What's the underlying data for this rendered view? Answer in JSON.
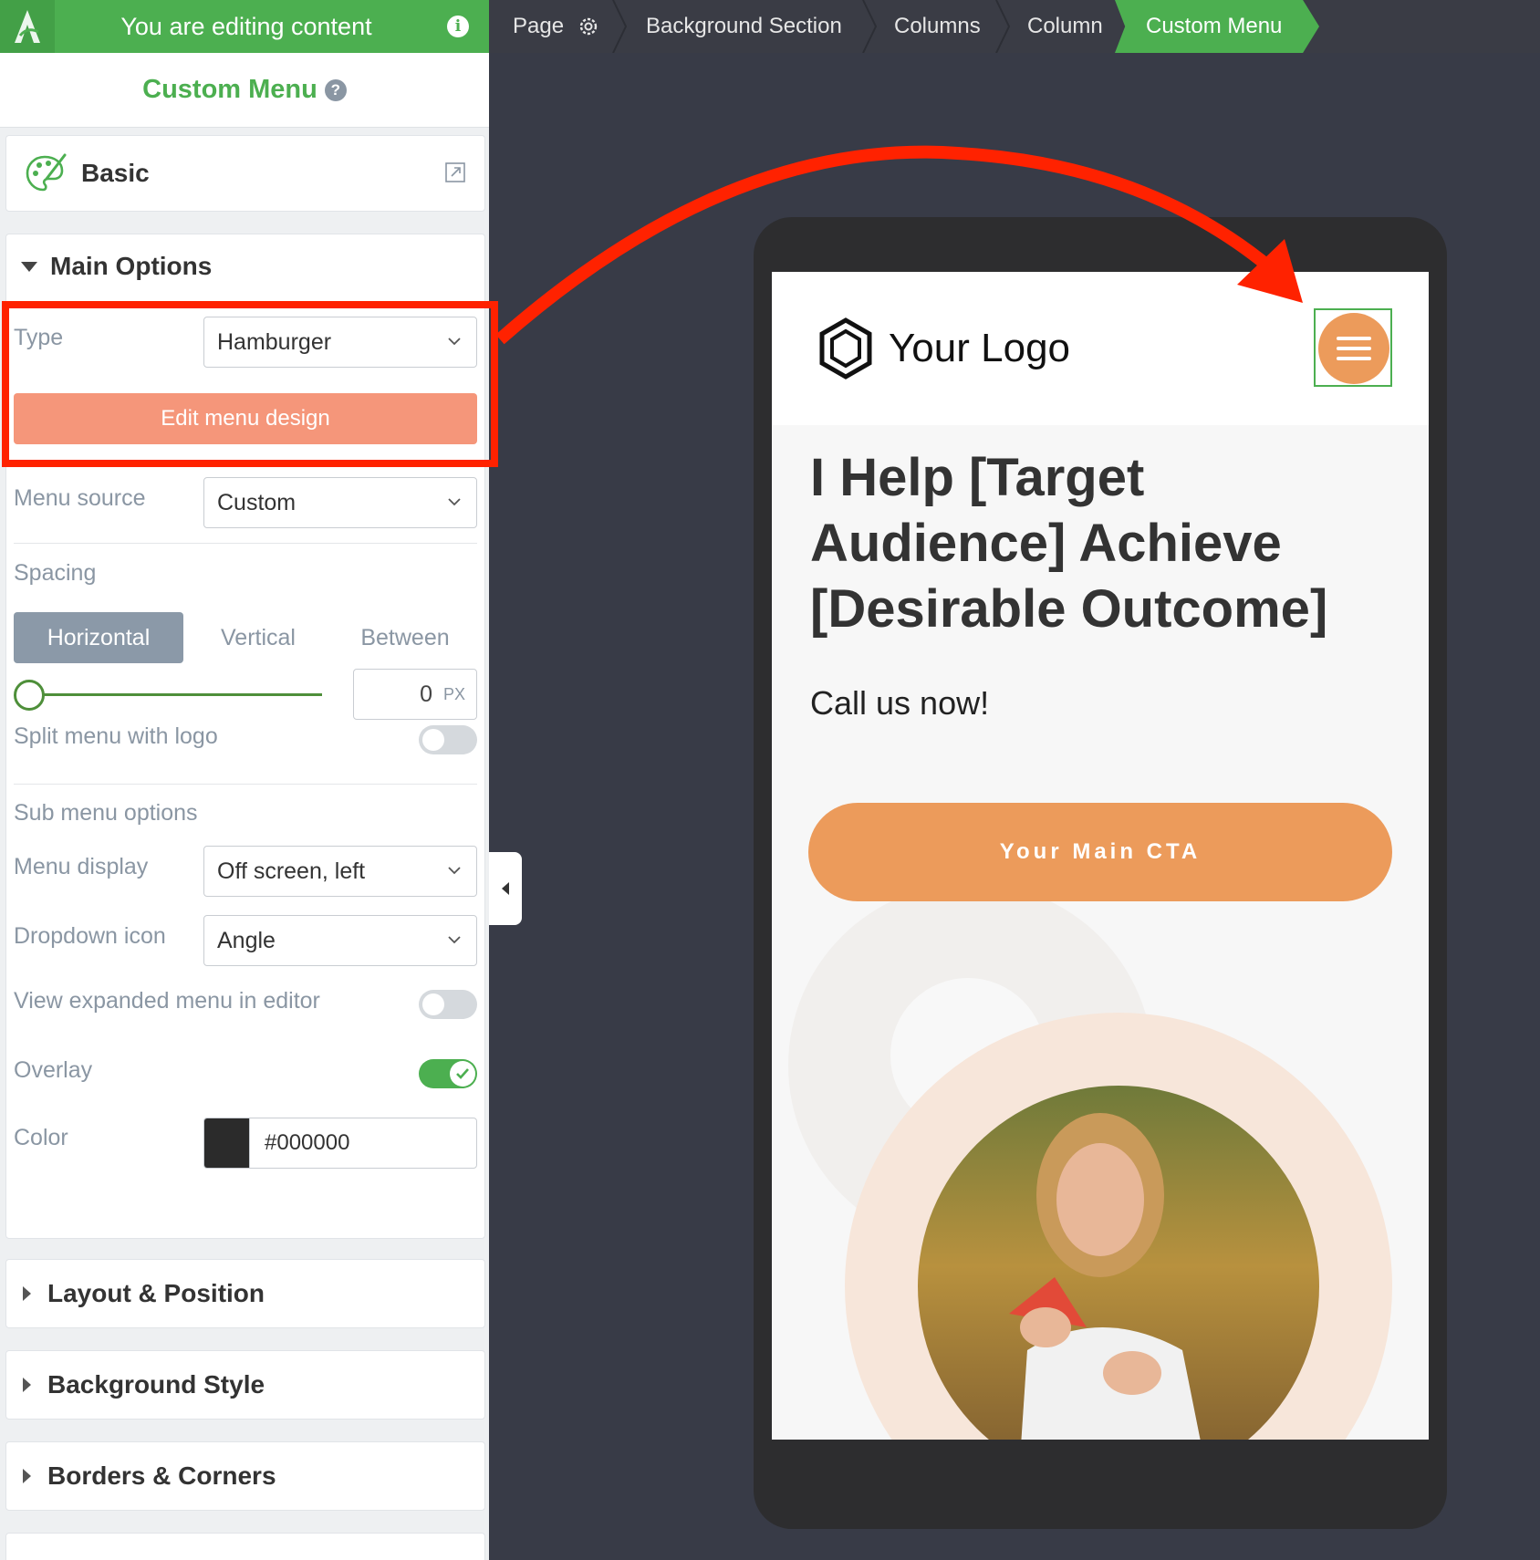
{
  "topbar": {
    "editing_text": "You are editing content",
    "breadcrumbs": [
      "Page",
      "Background Section",
      "Columns",
      "Column"
    ],
    "active_crumb": "Custom Menu"
  },
  "panel": {
    "title": "Custom Menu",
    "basic_label": "Basic",
    "main_options": "Main Options",
    "type_label": "Type",
    "type_value": "Hamburger",
    "edit_design": "Edit menu design",
    "menu_source_label": "Menu source",
    "menu_source_value": "Custom",
    "spacing_label": "Spacing",
    "spacing_tabs": [
      "Horizontal",
      "Vertical",
      "Between"
    ],
    "spacing_value": "0",
    "spacing_unit": "PX",
    "split_menu_label": "Split menu with logo",
    "split_menu_on": false,
    "sub_menu_label": "Sub menu options",
    "menu_display_label": "Menu display",
    "menu_display_value": "Off screen, left",
    "dropdown_icon_label": "Dropdown icon",
    "dropdown_icon_value": "Angle",
    "view_expanded_label": "View expanded menu in editor",
    "view_expanded_on": false,
    "overlay_label": "Overlay",
    "overlay_on": true,
    "color_label": "Color",
    "color_value": "#000000",
    "sections": [
      "Layout & Position",
      "Background Style",
      "Borders & Corners"
    ]
  },
  "preview": {
    "logo_text": "Your Logo",
    "headline": "I Help [Target Audience] Achieve [Desirable Outcome]",
    "subhead": "Call us now!",
    "cta": "Your Main CTA"
  },
  "colors": {
    "accent_green": "#4caf50",
    "cta_orange": "#ec9b5b",
    "edit_button": "#f5967a",
    "annotation_red": "#ff2200"
  }
}
